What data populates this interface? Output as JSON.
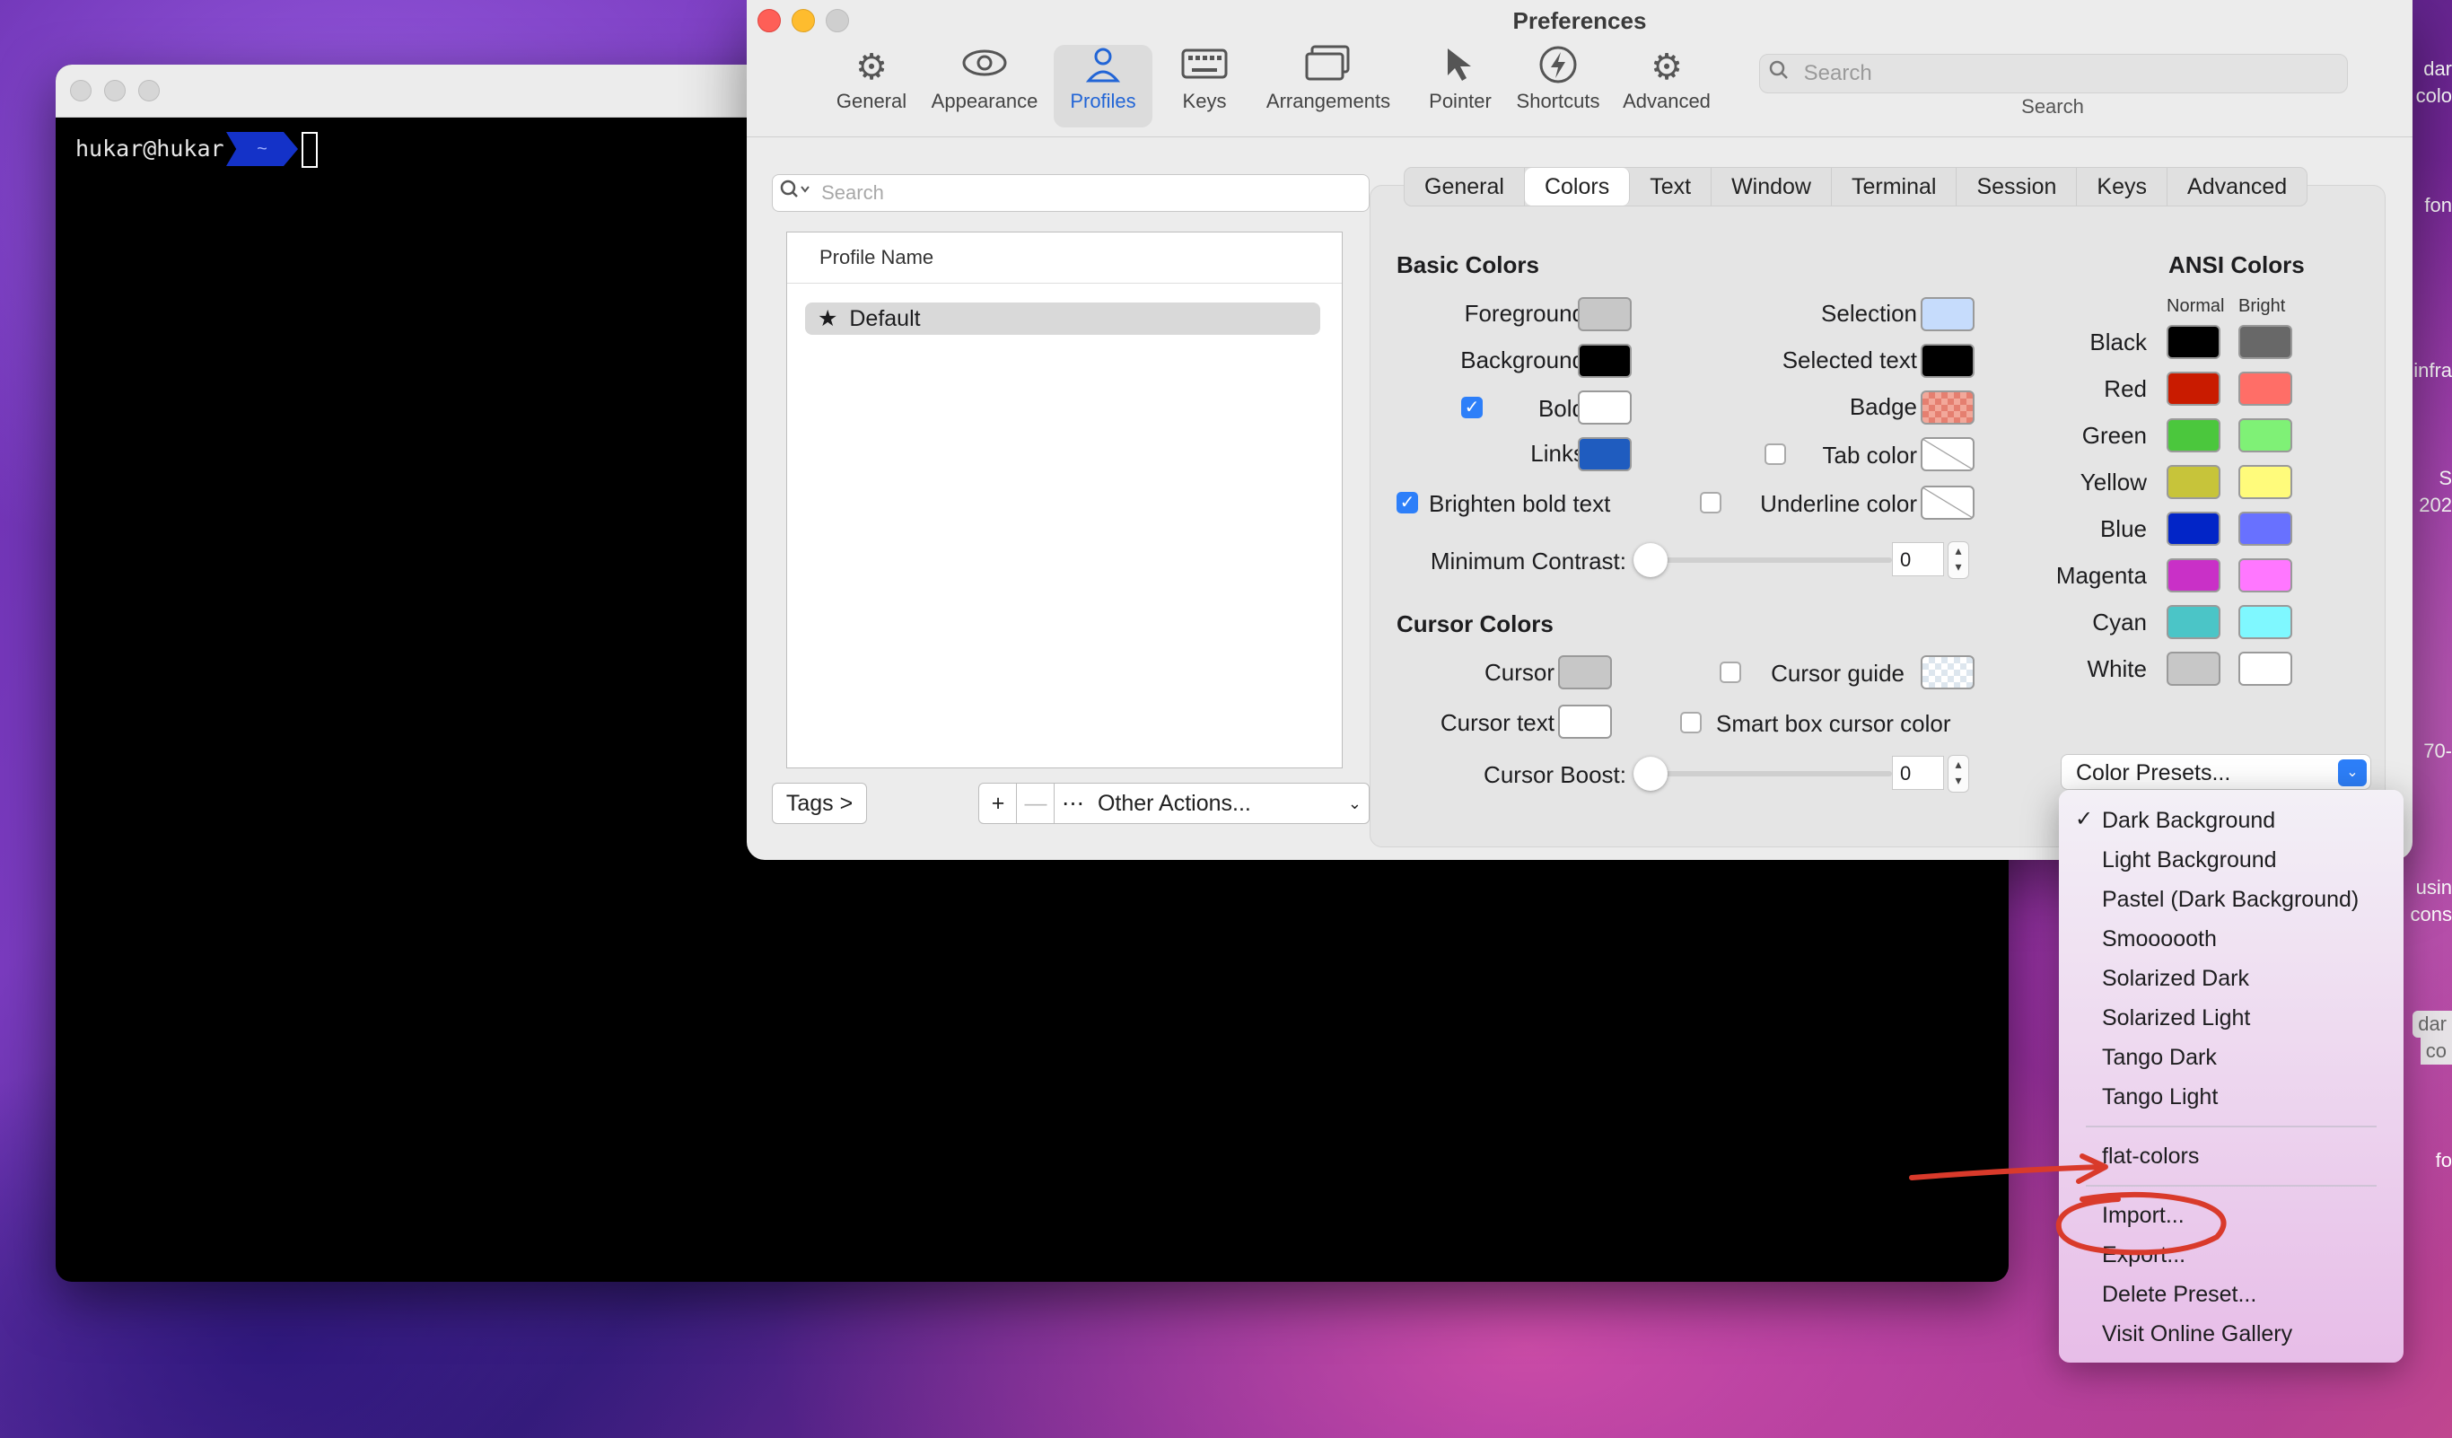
{
  "terminal": {
    "prompt_user": "hukar@hukar",
    "prompt_dir": "~"
  },
  "edge_fragments": [
    "dar",
    "colo",
    "fon",
    "infra",
    "S",
    "202",
    "70-",
    "usin",
    "cons",
    "dar",
    "co",
    "fo"
  ],
  "prefs": {
    "title": "Preferences",
    "toolbar": [
      {
        "label": "General",
        "icon": "gear-icon",
        "glyph": "⚙"
      },
      {
        "label": "Appearance",
        "icon": "eye-icon",
        "glyph": "👁"
      },
      {
        "label": "Profiles",
        "icon": "person-icon",
        "glyph": "👤"
      },
      {
        "label": "Keys",
        "icon": "keyboard-icon",
        "glyph": "⌨"
      },
      {
        "label": "Arrangements",
        "icon": "arrangements-icon",
        "glyph": "▭"
      },
      {
        "label": "Pointer",
        "icon": "pointer-icon",
        "glyph": "➤"
      },
      {
        "label": "Shortcuts",
        "icon": "bolt-icon",
        "glyph": "ϟ"
      },
      {
        "label": "Advanced",
        "icon": "gears-icon",
        "glyph": "⚙"
      }
    ],
    "search": {
      "placeholder": "Search",
      "label": "Search"
    },
    "profiles": {
      "search_placeholder": "Search",
      "column_header": "Profile Name",
      "items": [
        {
          "name": "Default",
          "icon": "star-icon"
        }
      ],
      "tags_button": "Tags >",
      "add": "+",
      "remove": "—",
      "other_actions": "Other Actions..."
    },
    "tabs": [
      "General",
      "Colors",
      "Text",
      "Window",
      "Terminal",
      "Session",
      "Keys",
      "Advanced"
    ],
    "selected_tab": "Colors",
    "basic": {
      "heading": "Basic Colors",
      "foreground": {
        "label": "Foreground",
        "color": "#c7c7c7"
      },
      "background": {
        "label": "Background",
        "color": "#000000"
      },
      "bold": {
        "label": "Bold",
        "checked": true,
        "color": "#ffffff"
      },
      "links": {
        "label": "Links",
        "color": "#1f5cbf"
      },
      "selection": {
        "label": "Selection",
        "color": "#c6dcfc"
      },
      "selected_text": {
        "label": "Selected text",
        "color": "#000000"
      },
      "badge": {
        "label": "Badge"
      },
      "tab_color": {
        "label": "Tab color",
        "checked": false
      },
      "underline_color": {
        "label": "Underline color",
        "checked": false
      },
      "brighten": {
        "label": "Brighten bold text",
        "checked": true
      },
      "min_contrast": {
        "label": "Minimum Contrast:",
        "value": "0"
      }
    },
    "cursor": {
      "heading": "Cursor Colors",
      "cursor": {
        "label": "Cursor",
        "color": "#c7c7c7"
      },
      "cursor_text": {
        "label": "Cursor text",
        "color": "#ffffff"
      },
      "cursor_guide": {
        "label": "Cursor guide",
        "checked": false
      },
      "smart_box": {
        "label": "Smart box cursor color",
        "checked": false
      },
      "boost": {
        "label": "Cursor Boost:",
        "value": "0"
      }
    },
    "ansi": {
      "heading": "ANSI Colors",
      "normal_label": "Normal",
      "bright_label": "Bright",
      "rows": [
        {
          "name": "Black",
          "normal": "#000000",
          "bright": "#686868"
        },
        {
          "name": "Red",
          "normal": "#c91b00",
          "bright": "#ff6e67"
        },
        {
          "name": "Green",
          "normal": "#4bc73d",
          "bright": "#7ff176"
        },
        {
          "name": "Yellow",
          "normal": "#c7c43a",
          "bright": "#fffb7b"
        },
        {
          "name": "Blue",
          "normal": "#0225c7",
          "bright": "#6871ff"
        },
        {
          "name": "Magenta",
          "normal": "#c930c7",
          "bright": "#ff77ff"
        },
        {
          "name": "Cyan",
          "normal": "#4bc5c7",
          "bright": "#7ff8ff"
        },
        {
          "name": "White",
          "normal": "#c7c7c7",
          "bright": "#ffffff"
        }
      ]
    },
    "color_presets": "Color Presets..."
  },
  "presets_menu": {
    "builtin": [
      "Dark Background",
      "Light Background",
      "Pastel (Dark Background)",
      "Smoooooth",
      "Solarized Dark",
      "Solarized Light",
      "Tango Dark",
      "Tango Light"
    ],
    "checked": "Dark Background",
    "custom": [
      "flat-colors"
    ],
    "actions": [
      "Import...",
      "Export...",
      "Delete Preset...",
      "Visit Online Gallery"
    ]
  },
  "colors": {
    "accent": "#2d7ff9",
    "annotation": "#d93a2b"
  }
}
